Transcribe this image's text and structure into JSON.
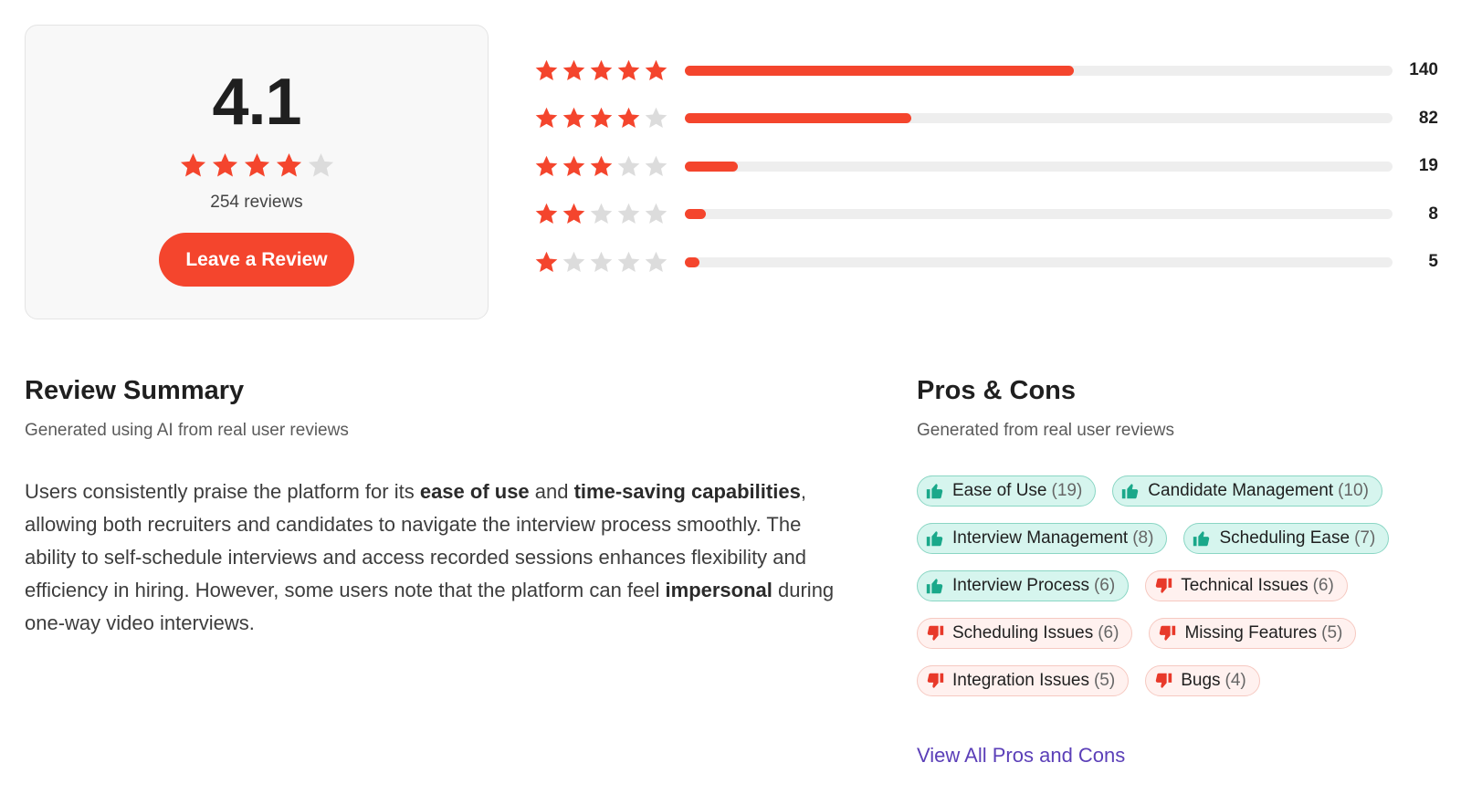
{
  "overall": {
    "average": "4.1",
    "rating_stars": 4,
    "review_count_text": "254 reviews",
    "leave_review_label": "Leave a Review"
  },
  "distribution": [
    {
      "stars": 5,
      "count": "140",
      "fraction": 0.55
    },
    {
      "stars": 4,
      "count": "82",
      "fraction": 0.32
    },
    {
      "stars": 3,
      "count": "19",
      "fraction": 0.075
    },
    {
      "stars": 2,
      "count": "8",
      "fraction": 0.03
    },
    {
      "stars": 1,
      "count": "5",
      "fraction": 0.02
    }
  ],
  "summary": {
    "title": "Review Summary",
    "subtitle": "Generated using AI from real user reviews",
    "segments": [
      {
        "text": "Users consistently praise the platform for its ",
        "bold": false
      },
      {
        "text": "ease of use",
        "bold": true
      },
      {
        "text": " and ",
        "bold": false
      },
      {
        "text": "time-saving capabilities",
        "bold": true
      },
      {
        "text": ", allowing both recruiters and candidates to navigate the interview process smoothly. The ability to self-schedule interviews and access recorded sessions enhances flexibility and efficiency in hiring. However, some users note that the platform can feel ",
        "bold": false
      },
      {
        "text": "impersonal",
        "bold": true
      },
      {
        "text": " during one-way video interviews.",
        "bold": false
      }
    ]
  },
  "proscons": {
    "title": "Pros & Cons",
    "subtitle": "Generated from real user reviews",
    "tags": [
      {
        "type": "pro",
        "label": "Ease of Use",
        "count": "(19)"
      },
      {
        "type": "pro",
        "label": "Candidate Management",
        "count": "(10)"
      },
      {
        "type": "pro",
        "label": "Interview Management",
        "count": "(8)"
      },
      {
        "type": "pro",
        "label": "Scheduling Ease",
        "count": "(7)"
      },
      {
        "type": "pro",
        "label": "Interview Process",
        "count": "(6)"
      },
      {
        "type": "con",
        "label": "Technical Issues",
        "count": "(6)"
      },
      {
        "type": "con",
        "label": "Scheduling Issues",
        "count": "(6)"
      },
      {
        "type": "con",
        "label": "Missing Features",
        "count": "(5)"
      },
      {
        "type": "con",
        "label": "Integration Issues",
        "count": "(5)"
      },
      {
        "type": "con",
        "label": "Bugs",
        "count": "(4)"
      }
    ],
    "view_all_label": "View All Pros and Cons"
  },
  "colors": {
    "accent": "#f4452d",
    "star_empty": "#dcdcdc",
    "pro_icon": "#1aa88a",
    "con_icon": "#e8392a",
    "link": "#5b3fb8"
  },
  "icons": {
    "star": "star-icon",
    "pro": "thumbs-up-icon",
    "con": "thumbs-down-icon"
  }
}
